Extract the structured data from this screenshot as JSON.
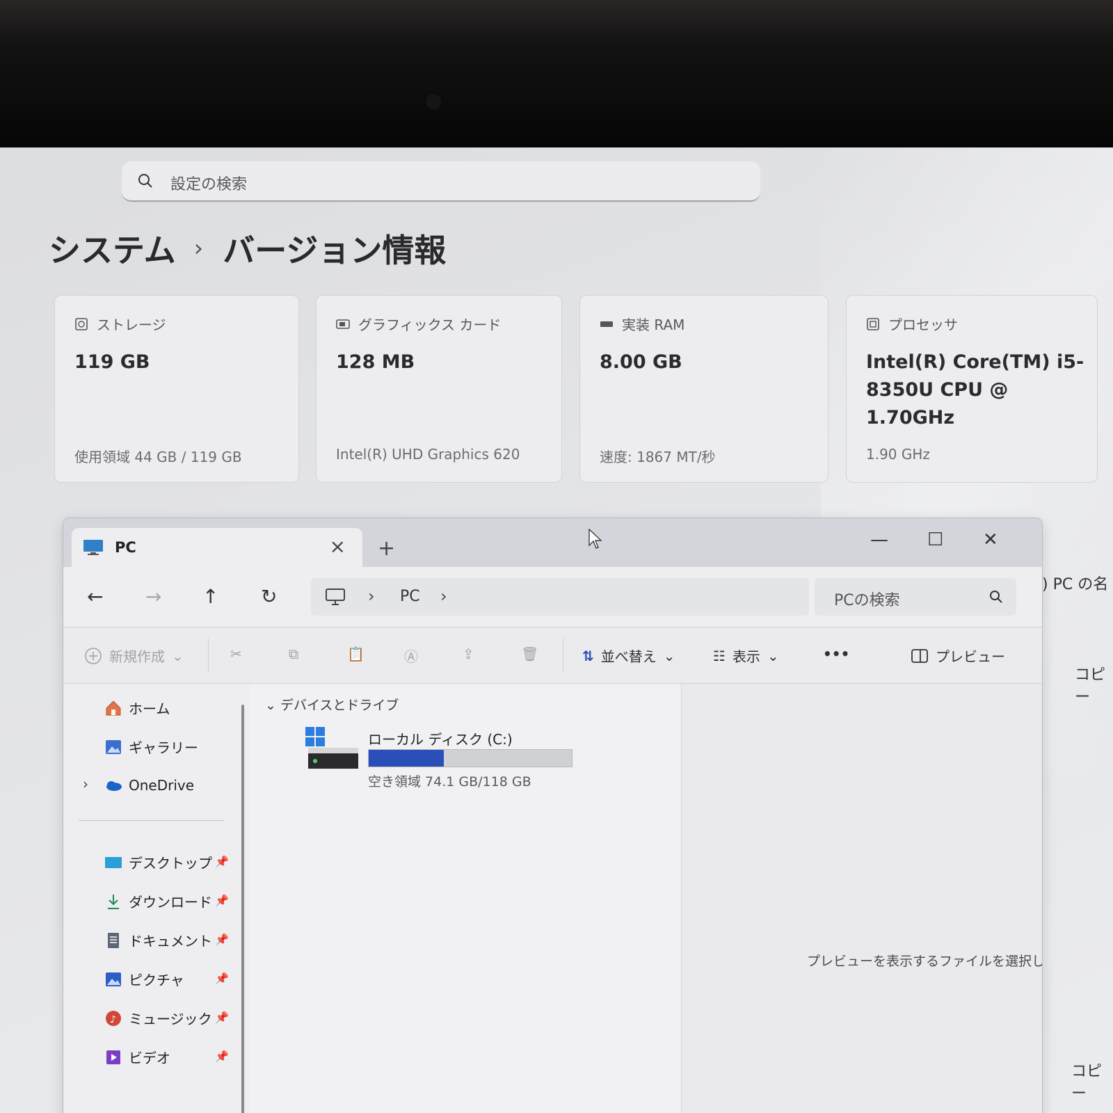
{
  "settings": {
    "search_placeholder": "設定の検索",
    "breadcrumb": {
      "parent": "システム",
      "current": "バージョン情報"
    },
    "cards": [
      {
        "label": "ストレージ",
        "value": "119 GB",
        "detail": "使用領域 44 GB / 119 GB"
      },
      {
        "label": "グラフィックス カード",
        "value": "128 MB",
        "detail": "Intel(R) UHD Graphics 620"
      },
      {
        "label": "実装 RAM",
        "value": "8.00 GB",
        "detail": "速度: 1867 MT/秒"
      },
      {
        "label": "プロセッサ",
        "value": "Intel(R) Core(TM) i5-8350U CPU @ 1.70GHz",
        "detail": "1.90 GHz"
      }
    ],
    "peek": {
      "name_label": ") PC の名",
      "copy1": "コピー",
      "copy2": "コピー"
    }
  },
  "explorer": {
    "tab_title": "PC",
    "address": {
      "segment": "PC"
    },
    "search_placeholder": "PCの検索",
    "commands": {
      "new_label": "新規作成",
      "sort_label": "並べ替え",
      "view_label": "表示",
      "more_label": "•••",
      "preview_label": "プレビュー"
    },
    "sidebar": {
      "top_items": [
        {
          "label": "ホーム"
        },
        {
          "label": "ギャラリー"
        },
        {
          "label": "OneDrive"
        }
      ],
      "pinned_items": [
        {
          "label": "デスクトップ"
        },
        {
          "label": "ダウンロード"
        },
        {
          "label": "ドキュメント"
        },
        {
          "label": "ピクチャ"
        },
        {
          "label": "ミュージック"
        },
        {
          "label": "ビデオ"
        }
      ]
    },
    "content": {
      "group_header": "デバイスとドライブ",
      "drives": [
        {
          "name": "ローカル ディスク (C:)",
          "free_text": "空き領域 74.1 GB/118 GB",
          "used_fraction": 0.37
        }
      ]
    },
    "preview_message": "プレビューを表示するファイルを選択します。"
  },
  "colors": {
    "accent": "#2b4fb8",
    "background": "#e4e5e8"
  }
}
